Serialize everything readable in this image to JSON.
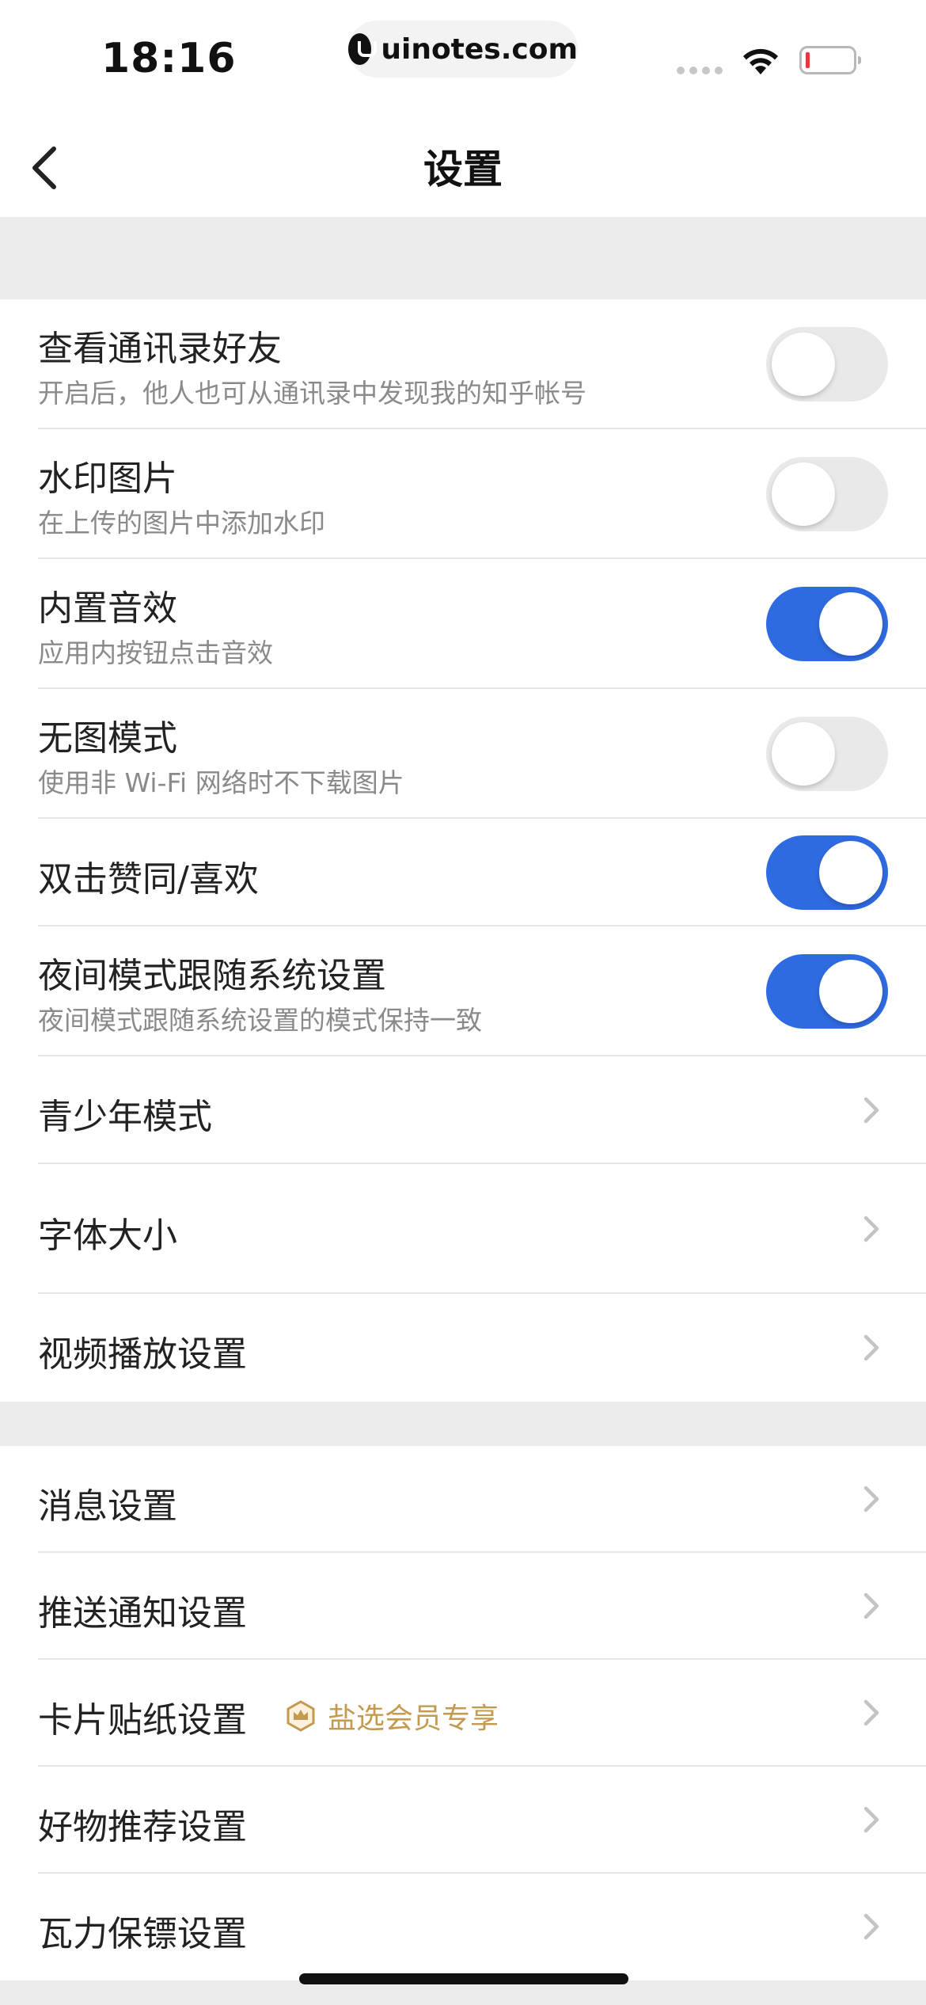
{
  "status_bar": {
    "time": "18:16",
    "url": "uinotes.com"
  },
  "nav": {
    "title": "设置"
  },
  "colors": {
    "accent": "#2f6be0",
    "vip": "#c49a50"
  },
  "section1": {
    "rows": [
      {
        "title": "查看通讯录好友",
        "subtitle": "开启后，他人也可从通讯录中发现我的知乎帐号",
        "toggle": "off"
      },
      {
        "title": "水印图片",
        "subtitle": "在上传的图片中添加水印",
        "toggle": "off"
      },
      {
        "title": "内置音效",
        "subtitle": "应用内按钮点击音效",
        "toggle": "on"
      },
      {
        "title": "无图模式",
        "subtitle": "使用非 Wi-Fi 网络时不下载图片",
        "toggle": "off"
      },
      {
        "title": "双击赞同/喜欢",
        "toggle": "on"
      },
      {
        "title": "夜间模式跟随系统设置",
        "subtitle": "夜间模式跟随系统设置的模式保持一致",
        "toggle": "on"
      },
      {
        "title": "青少年模式"
      },
      {
        "title": "字体大小"
      },
      {
        "title": "视频播放设置"
      }
    ]
  },
  "section2": {
    "rows": [
      {
        "title": "消息设置"
      },
      {
        "title": "推送通知设置"
      },
      {
        "title": "卡片贴纸设置",
        "badge": "盐选会员专享"
      },
      {
        "title": "好物推荐设置"
      },
      {
        "title": "瓦力保镖设置"
      }
    ]
  }
}
